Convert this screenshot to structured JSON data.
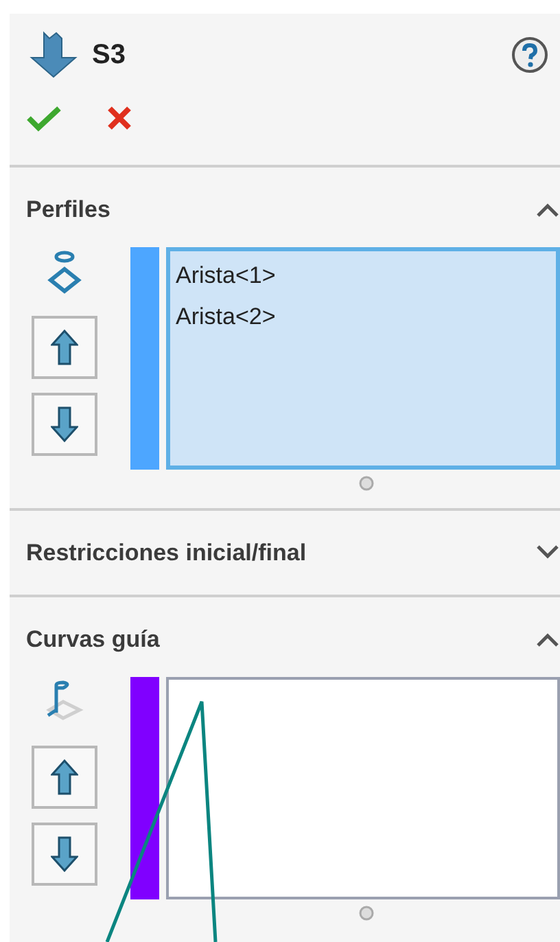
{
  "header": {
    "title": "S3"
  },
  "sections": [
    {
      "kind": "profiles",
      "title": "Perfiles",
      "expanded": true,
      "color": "#4da6ff",
      "selected": true,
      "items": [
        "Arista<1>",
        "Arista<2>"
      ]
    },
    {
      "title": "Restricciones inicial/final",
      "expanded": false
    },
    {
      "kind": "guides",
      "title": "Curvas guía",
      "expanded": true,
      "color": "#8000ff",
      "selected": false
    }
  ]
}
